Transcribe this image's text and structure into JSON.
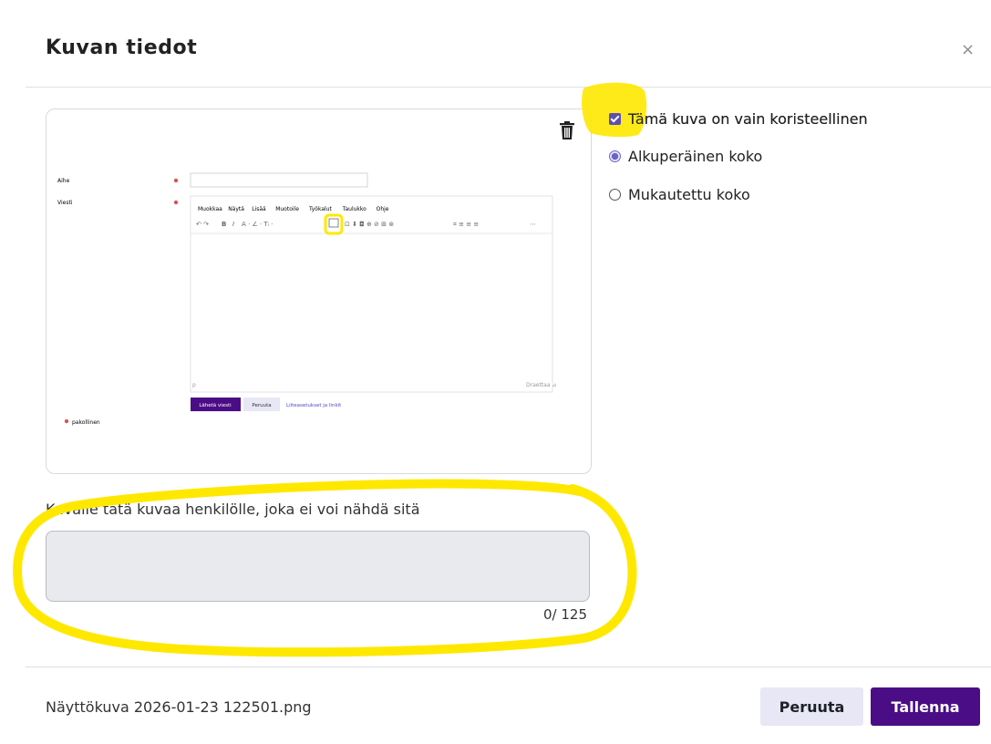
{
  "dialog": {
    "title": "Kuvan tiedot",
    "close_glyph": "×"
  },
  "options": {
    "decorative_label": "Tämä kuva on vain koristeellinen",
    "decorative_checked": true,
    "size_original_label": "Alkuperäinen koko",
    "size_custom_label": "Mukautettu koko",
    "size_selected": "original"
  },
  "preview": {
    "field_subject": "Aihe",
    "field_message": "Viesti",
    "menubar": [
      "Muokkaa",
      "Näytä",
      "Lisää",
      "Muotoile",
      "Työkalut",
      "Taulukko",
      "Ohje"
    ],
    "send_button": "Lähetä viesti",
    "cancel_button": "Peruuta",
    "attachments_link": "Liiteasetukset ja linkit",
    "required_note": "pakollinen"
  },
  "description": {
    "label": "Kuvaile tätä kuvaa henkilölle, joka ei voi nähdä sitä",
    "value": "",
    "counter": "0/ 125"
  },
  "footer": {
    "filename": "Näyttökuva 2026-01-23 122501.png",
    "cancel_label": "Peruuta",
    "save_label": "Tallenna"
  },
  "colors": {
    "primary": "#4b0d86",
    "secondary_button_bg": "#e7e7f5",
    "highlight": "#ffe800"
  }
}
